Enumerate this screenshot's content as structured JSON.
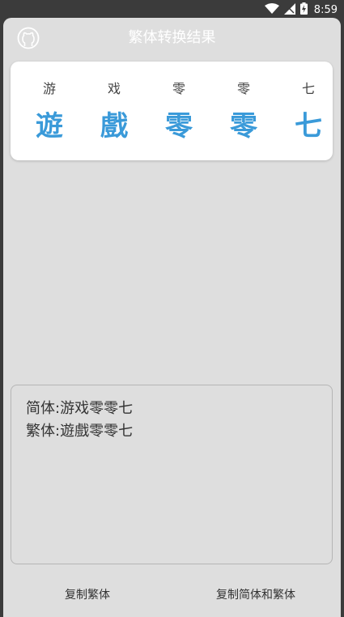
{
  "status_bar": {
    "time": "8:59",
    "icons": [
      "wifi-icon",
      "signal-icon",
      "battery-charging-icon"
    ]
  },
  "dialog": {
    "title": "繁体转换结果",
    "github_icon": "github-icon"
  },
  "characters": [
    {
      "simplified": "游",
      "traditional": "遊"
    },
    {
      "simplified": "戏",
      "traditional": "戲"
    },
    {
      "simplified": "零",
      "traditional": "零"
    },
    {
      "simplified": "零",
      "traditional": "零"
    },
    {
      "simplified": "七",
      "traditional": "七"
    }
  ],
  "result": {
    "simplified_line": "简体:游戏零零七",
    "traditional_line": "繁体:遊戲零零七"
  },
  "buttons": {
    "copy_traditional": "复制繁体",
    "copy_both": "复制简体和繁体"
  },
  "colors": {
    "accent": "#3a9ad9",
    "panel_bg": "#dedede",
    "card_bg": "#ffffff",
    "status_bg": "#3b3b3b"
  }
}
